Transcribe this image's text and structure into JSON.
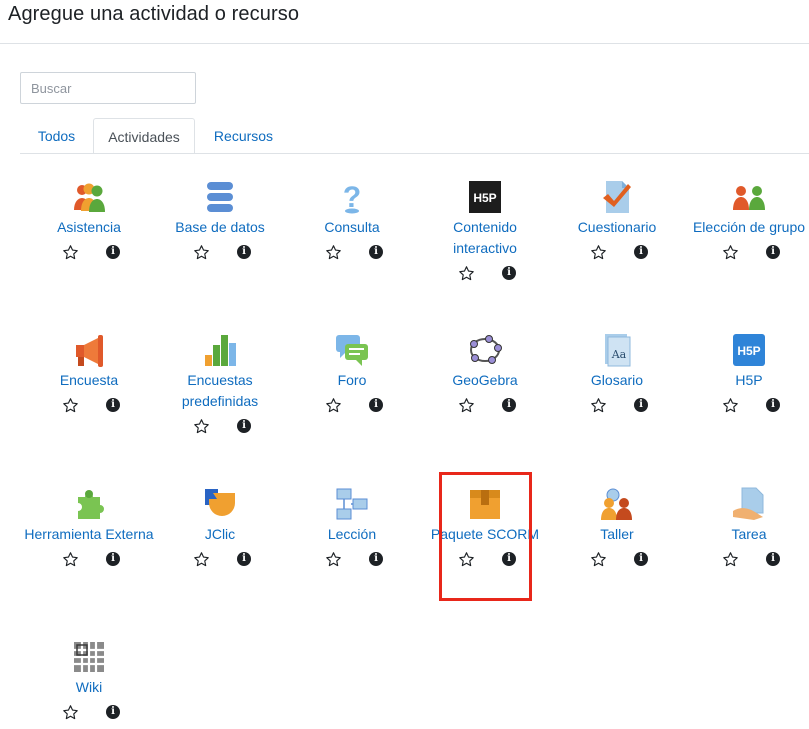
{
  "dialog": {
    "title": "Agregue una actividad o recurso"
  },
  "search": {
    "placeholder": "Buscar"
  },
  "tabs": [
    {
      "label": "Todos"
    },
    {
      "label": "Actividades"
    },
    {
      "label": "Recursos"
    }
  ],
  "active_tab": "Actividades",
  "info_glyph": "i",
  "items": [
    {
      "label": "Asistencia",
      "icon": "attendance-icon"
    },
    {
      "label": "Base de datos",
      "icon": "database-icon"
    },
    {
      "label": "Consulta",
      "icon": "question-icon"
    },
    {
      "label": "Contenido interactivo",
      "icon": "h5p-dark-icon"
    },
    {
      "label": "Cuestionario",
      "icon": "quiz-icon"
    },
    {
      "label": "Elección de grupo",
      "icon": "group-choice-icon"
    },
    {
      "label": "Encuesta",
      "icon": "megaphone-icon"
    },
    {
      "label": "Encuestas predefinidas",
      "icon": "bar-chart-icon"
    },
    {
      "label": "Foro",
      "icon": "forum-icon"
    },
    {
      "label": "GeoGebra",
      "icon": "geogebra-icon"
    },
    {
      "label": "Glosario",
      "icon": "glossary-icon"
    },
    {
      "label": "H5P",
      "icon": "h5p-blue-icon"
    },
    {
      "label": "Herramienta Externa",
      "icon": "puzzle-icon"
    },
    {
      "label": "JClic",
      "icon": "jclic-icon"
    },
    {
      "label": "Lección",
      "icon": "lesson-icon"
    },
    {
      "label": "Paquete SCORM",
      "icon": "package-icon"
    },
    {
      "label": "Taller",
      "icon": "workshop-icon"
    },
    {
      "label": "Tarea",
      "icon": "assignment-icon"
    },
    {
      "label": "Wiki",
      "icon": "wiki-icon"
    }
  ],
  "colors": {
    "link": "#0f6cbf",
    "highlight": "#e8271a",
    "text": "#1d2125"
  }
}
